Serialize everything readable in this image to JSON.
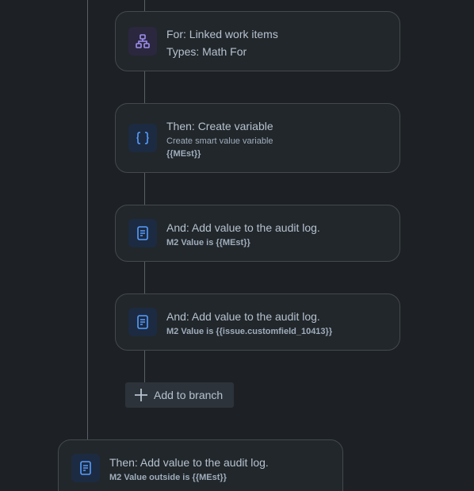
{
  "colors": {
    "background": "#1d2125",
    "card": "#22272b",
    "card_border": "#44494f",
    "connector": "#5a6068",
    "branch_icon": "#9f8fef",
    "smart_value_icon": "#579dff",
    "log_icon": "#579dff"
  },
  "cards": {
    "branch": {
      "icon": "branch-icon",
      "title": "For: Linked work items",
      "subtitle": "Types: Math For"
    },
    "create_variable": {
      "icon": "curly-braces-icon",
      "title": "Then: Create variable",
      "description": "Create smart value variable",
      "value": "{{MEst}}"
    },
    "audit_log_1": {
      "icon": "document-icon",
      "title": "And: Add value to the audit log.",
      "value": "M2 Value is {{MEst}}"
    },
    "audit_log_2": {
      "icon": "document-icon",
      "title": "And: Add value to the audit log.",
      "value": "M2 Value is {{issue.customfield_10413}}"
    },
    "audit_log_outside": {
      "icon": "document-icon",
      "title": "Then: Add value to the audit log.",
      "value": "M2 Value outside is {{MEst}}"
    }
  },
  "add_to_branch": {
    "icon": "plus-icon",
    "label": "Add to branch"
  }
}
